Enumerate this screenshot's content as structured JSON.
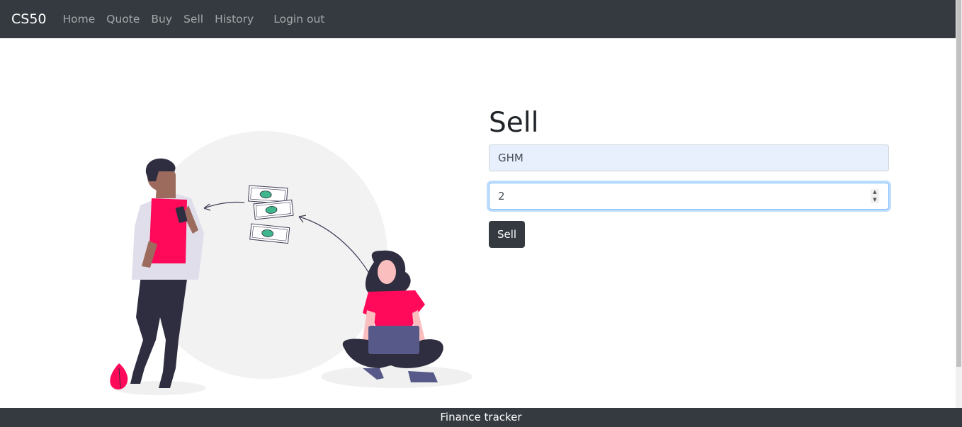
{
  "navbar": {
    "brand": "CS50",
    "links": [
      "Home",
      "Quote",
      "Buy",
      "Sell",
      "History",
      "Login out"
    ]
  },
  "form": {
    "title": "Sell",
    "symbol_value": "GHM",
    "shares_value": "2",
    "submit_label": "Sell"
  },
  "footer": {
    "text": "Finance tracker"
  },
  "colors": {
    "navbar_bg": "#343a40",
    "accent_pink": "#ff0a5a",
    "input_focus": "#80bdff"
  },
  "icons": {
    "spinner_up": "▲",
    "spinner_down": "▼"
  }
}
